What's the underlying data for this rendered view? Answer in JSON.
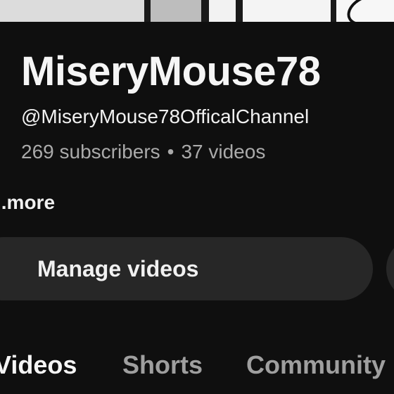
{
  "channel": {
    "name": "MiseryMouse78",
    "handle": "@MiseryMouse78OfficalChannel",
    "subscribers": "269 subscribers",
    "separator": "•",
    "videos": "37 videos",
    "more_label": "..more"
  },
  "actions": {
    "manage_videos_label": "Manage videos"
  },
  "tabs": [
    {
      "label": "Videos",
      "active": true
    },
    {
      "label": "Shorts",
      "active": false
    },
    {
      "label": "Community",
      "active": false
    }
  ],
  "colors": {
    "background": "#0f0f0f",
    "button": "#272727",
    "secondary_text": "#aaaaaa"
  }
}
